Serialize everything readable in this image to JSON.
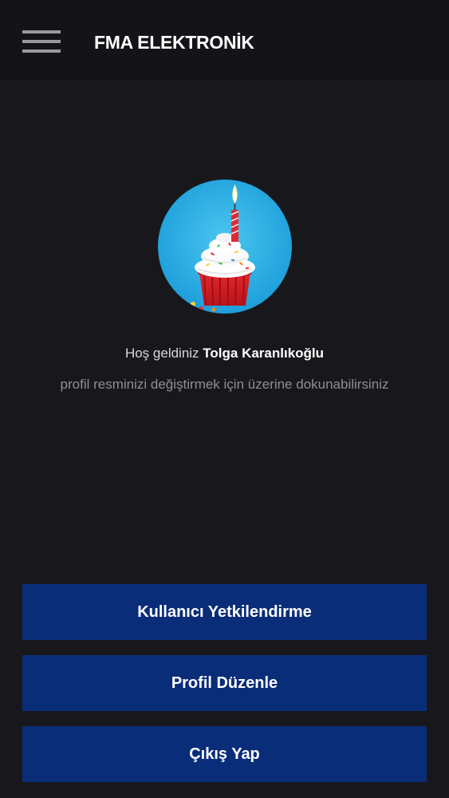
{
  "app_bar": {
    "title": "FMA ELEKTRONİK",
    "menu_icon": "hamburger-menu-icon"
  },
  "profile": {
    "avatar_image": "birthday-cupcake-with-candle",
    "welcome_prefix": "Hoş geldiniz ",
    "user_name": "Tolga Karanlıkoğlu",
    "hint": "profil resminizi değiştirmek için üzerine dokunabilirsiniz"
  },
  "actions": {
    "user_authorization": "Kullanıcı Yetkilendirme",
    "edit_profile": "Profil Düzenle",
    "logout": "Çıkış Yap"
  },
  "colors": {
    "background": "#18181c",
    "app_bar": "#141418",
    "button": "#0a2d7a",
    "text_primary": "#ffffff",
    "text_secondary": "#8f8f8f"
  }
}
